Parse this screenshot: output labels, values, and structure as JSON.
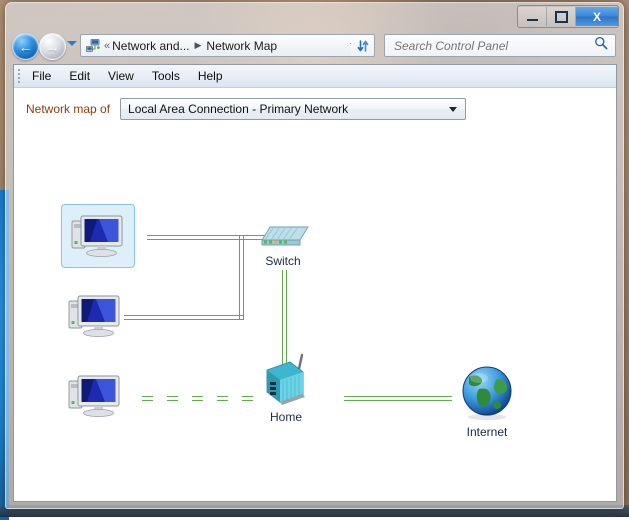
{
  "window": {
    "controls": {
      "minimize_label": "–",
      "maximize_label": "□",
      "close_label": "X"
    }
  },
  "nav": {
    "back_glyph": "←",
    "forward_glyph": "→",
    "address_icon": "network-icon",
    "crumb_overflow": "«",
    "crumb_parent": "Network and...",
    "crumb_separator": "▶",
    "crumb_current": "Network Map",
    "refresh_glyph": "⇅"
  },
  "search": {
    "placeholder": "Search Control Panel",
    "icon_glyph": "⌕"
  },
  "menu": {
    "items": [
      {
        "label": "File"
      },
      {
        "label": "Edit"
      },
      {
        "label": "View"
      },
      {
        "label": "Tools"
      },
      {
        "label": "Help"
      }
    ]
  },
  "map_selector": {
    "label": "Network map of",
    "selected": "Local Area Connection - Primary Network",
    "options": [
      "Local Area Connection - Primary Network"
    ]
  },
  "network_map": {
    "nodes": [
      {
        "id": "pc1",
        "label": "",
        "icon": "computer-icon",
        "selected": true
      },
      {
        "id": "pc2",
        "label": "",
        "icon": "computer-icon",
        "selected": false
      },
      {
        "id": "pc3",
        "label": "",
        "icon": "computer-icon",
        "selected": false
      },
      {
        "id": "switch",
        "label": "Switch",
        "icon": "switch-icon",
        "selected": false
      },
      {
        "id": "home",
        "label": "Home",
        "icon": "router-icon",
        "selected": false
      },
      {
        "id": "internet",
        "label": "Internet",
        "icon": "globe-icon",
        "selected": false
      }
    ],
    "links": [
      {
        "from": "pc1",
        "to": "switch",
        "style": "solid"
      },
      {
        "from": "pc2",
        "to": "switch",
        "style": "solid"
      },
      {
        "from": "switch",
        "to": "home",
        "style": "solid"
      },
      {
        "from": "pc3",
        "to": "home",
        "style": "dashed"
      },
      {
        "from": "home",
        "to": "internet",
        "style": "solid"
      }
    ],
    "link_color": "#63a84e"
  }
}
